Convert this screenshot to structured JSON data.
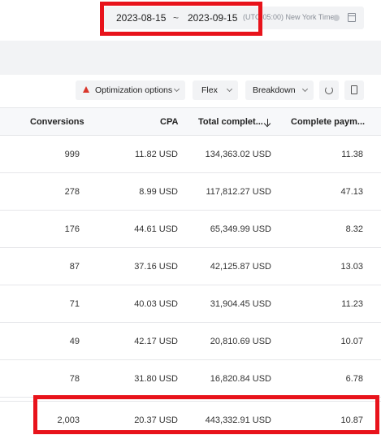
{
  "date_range": {
    "start": "2023-08-15",
    "separator": "~",
    "end": "2023-09-15",
    "timezone": "(UTC-05:00) New York Time",
    "highlight_color": "#e8131b"
  },
  "toolbar": {
    "optimization_label": "Optimization options",
    "flex_label": "Flex",
    "breakdown_label": "Breakdown",
    "refresh_icon": "refresh-icon",
    "export_icon": "export-icon"
  },
  "table": {
    "headers": {
      "conversions": "Conversions",
      "cpa": "CPA",
      "total": "Total complet...",
      "payment": "Complete paym..."
    },
    "rows": [
      {
        "conversions": "999",
        "cpa": "11.82 USD",
        "total": "134,363.02 USD",
        "payment": "11.38"
      },
      {
        "conversions": "278",
        "cpa": "8.99 USD",
        "total": "117,812.27 USD",
        "payment": "47.13"
      },
      {
        "conversions": "176",
        "cpa": "44.61 USD",
        "total": "65,349.99 USD",
        "payment": "8.32"
      },
      {
        "conversions": "87",
        "cpa": "37.16 USD",
        "total": "42,125.87 USD",
        "payment": "13.03"
      },
      {
        "conversions": "71",
        "cpa": "40.03 USD",
        "total": "31,904.45 USD",
        "payment": "11.23"
      },
      {
        "conversions": "49",
        "cpa": "42.17 USD",
        "total": "20,810.69 USD",
        "payment": "10.07"
      },
      {
        "conversions": "78",
        "cpa": "31.80 USD",
        "total": "16,820.84 USD",
        "payment": "6.78"
      }
    ],
    "total": {
      "conversions": "2,003",
      "cpa": "20.37 USD",
      "total": "443,332.91 USD",
      "payment": "10.87"
    }
  }
}
